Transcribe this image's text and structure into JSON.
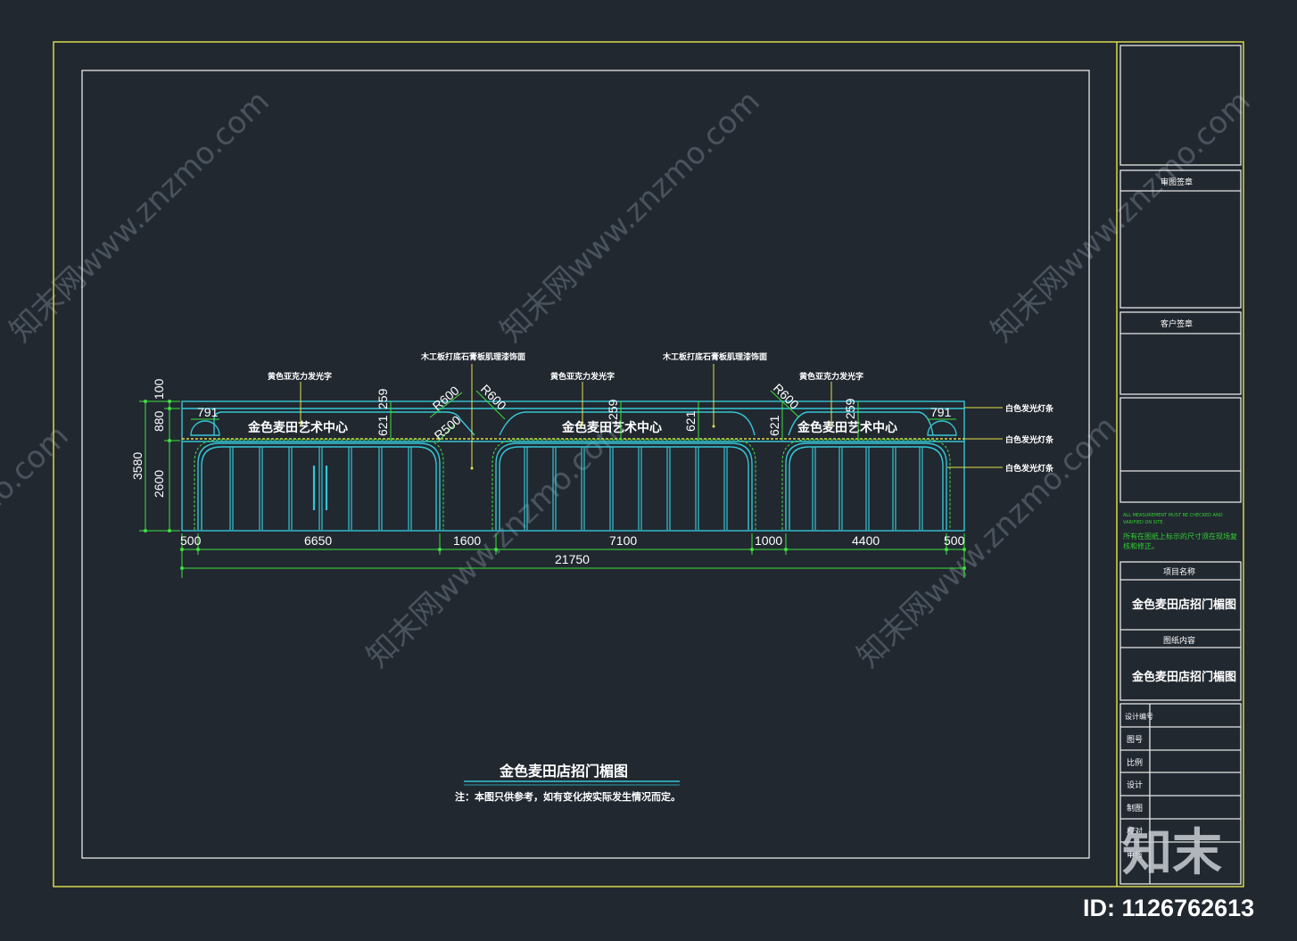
{
  "colors": {
    "background": "#212830",
    "frame": "#d8d84a",
    "border": "#e6e6e6",
    "facade": "#35c6d6",
    "dimension": "#3fe03f",
    "leader": "#e6e04a",
    "accent_green": "#33cc33",
    "watermark": "#5b646e"
  },
  "sign_text": "金色麦田艺术中心",
  "annotations": {
    "yellow_acrylic_left": "黄色亚克力发光字",
    "yellow_acrylic_mid": "黄色亚克力发光字",
    "yellow_acrylic_right": "黄色亚克力发光字",
    "wood_board_left": "木工板打底石膏板肌理漆饰面",
    "wood_board_right": "木工板打底石膏板肌理漆饰面",
    "light_strip_1": "白色发光灯条",
    "light_strip_2": "白色发光灯条",
    "light_strip_3": "白色发光灯条"
  },
  "dimensions": {
    "bottom": [
      "500",
      "6650",
      "1600",
      "7100",
      "1000",
      "4400",
      "500"
    ],
    "total": "21750",
    "height_total": "3580",
    "height_lower": "2600",
    "height_band": "880",
    "height_top": "100",
    "end_width_left": "791",
    "end_width_right": "791",
    "gap_a": "259",
    "gap_b": "621",
    "gap_c": "259",
    "gap_d": "621",
    "gap_e": "259",
    "gap_f": "621",
    "radius_1": "R600",
    "radius_2": "R500",
    "radius_3": "R600",
    "radius_4": "R600"
  },
  "drawing": {
    "title": "金色麦田店招门楣图",
    "note": "注：本图只供参考，如有变化按实际发生情况而定。"
  },
  "title_block": {
    "review_stamp": "审图签章",
    "client_stamp": "客户签章",
    "notice_en_1": "ALL MEASUREMENT MUST BE CHECKED AND",
    "notice_en_2": "VARIFIED ON SITE.",
    "notice_cn_1": "所有在图纸上标示的尺寸须在现场复",
    "notice_cn_2": "核和修正。",
    "project_name_label": "项目名称",
    "project_name": "金色麦田店招门楣图",
    "drawing_content_label": "图纸内容",
    "drawing_content": "金色麦田店招门楣图",
    "rows": [
      "设计编号",
      "图号",
      "比例",
      "设计",
      "制图",
      "校对",
      "审核"
    ]
  },
  "watermark": {
    "text": "知末网www.znzmo.com",
    "logo": "知末",
    "id_text": "ID: 1126762613"
  }
}
